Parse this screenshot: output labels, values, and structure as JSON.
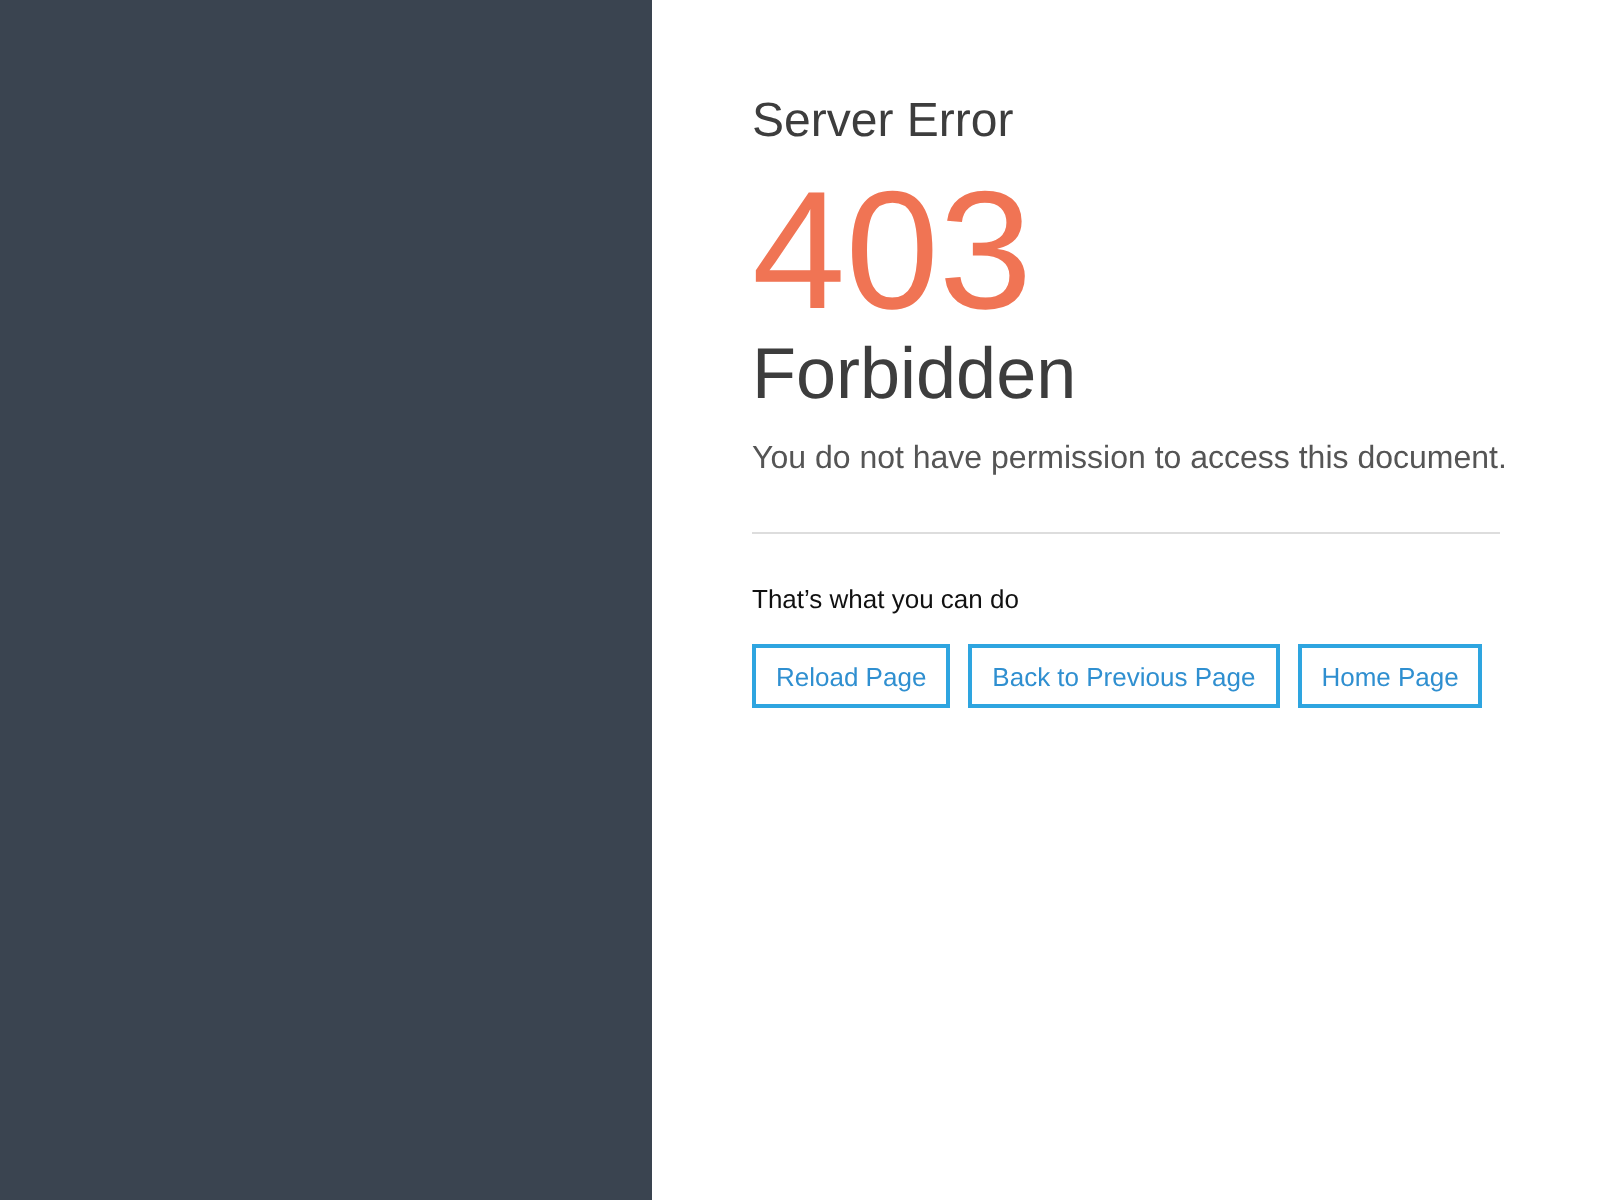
{
  "sidebar": {
    "kind": "panel"
  },
  "heading": "Server Error",
  "code": "403",
  "title": "Forbidden",
  "message": "You do not have permission to access this document.",
  "actions_label": "That’s what you can do",
  "buttons": [
    "Reload Page",
    "Back to Previous Page",
    "Home Page"
  ]
}
